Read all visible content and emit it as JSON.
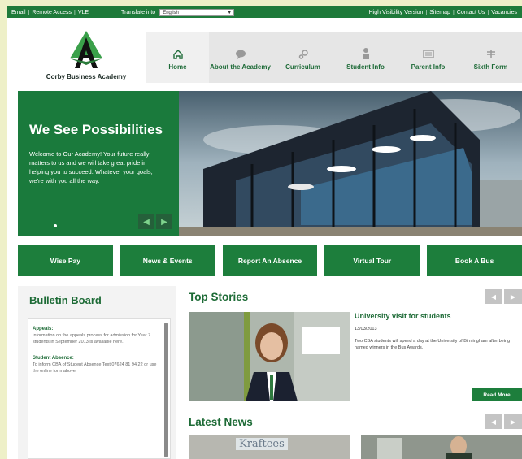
{
  "top_bar": {
    "links": [
      "Email",
      "Remote Access",
      "VLE"
    ],
    "translate_label": "Translate into",
    "language_select": "English",
    "right_links": [
      "High Visibility Version",
      "Sitemap",
      "Contact Us",
      "Vacancies"
    ]
  },
  "logo": {
    "name": "Corby Business Academy"
  },
  "nav": [
    {
      "label": "Home",
      "icon": "home-icon"
    },
    {
      "label": "About the Academy",
      "icon": "speech-bubble-icon"
    },
    {
      "label": "Curriculum",
      "icon": "gears-icon"
    },
    {
      "label": "Student Info",
      "icon": "student-icon"
    },
    {
      "label": "Parent Info",
      "icon": "parent-icon"
    },
    {
      "label": "Sixth Form",
      "icon": "sixth-form-icon"
    }
  ],
  "hero": {
    "title": "We See Possibilities",
    "body": "Welcome to Our Academy! Your future really matters to us and we will take great pride in helping you to succeed. Whatever your goals, we're with you all the way."
  },
  "quick_links": [
    "Wise Pay",
    "News & Events",
    "Report An Absence",
    "Virtual Tour",
    "Book A Bus"
  ],
  "bulletin": {
    "title": "Bulletin Board",
    "items": [
      {
        "heading": "Appeals:",
        "text": "Information on the appeals process for admission for Year 7 students in September 2013 is available here."
      },
      {
        "heading": "Student Absence:",
        "text": "To inform CBA of Student Absence Text 07624 81 94 22 or use the online form above."
      }
    ]
  },
  "top_stories": {
    "title": "Top Stories",
    "story_title": "University visit for students",
    "date": "13/03/2013",
    "body": "Two CBA students will spend a day at the University of Birmingham after being named winners in the Bus Awards.",
    "read_more": "Read More"
  },
  "latest_news": {
    "title": "Latest News",
    "image_text": "Kraftees"
  },
  "colors": {
    "brand_green": "#1d7e3c",
    "nav_bg": "#e6e6e6"
  }
}
